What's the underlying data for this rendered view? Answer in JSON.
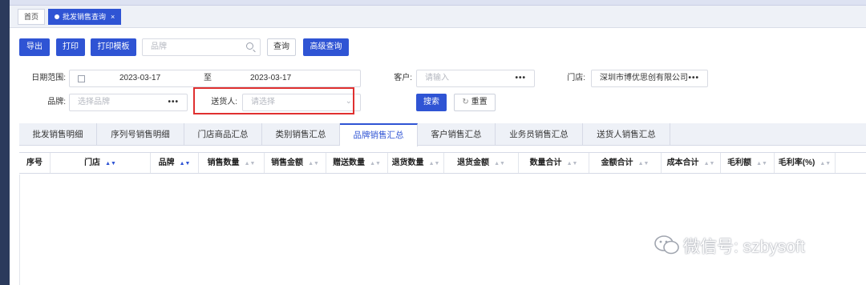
{
  "page_tabs": [
    {
      "label": "首页"
    },
    {
      "label": "批发销售查询",
      "close": "×"
    }
  ],
  "toolbar": {
    "export": "导出",
    "print": "打印",
    "print_template": "打印模板",
    "brand_placeholder": "品牌",
    "query": "查询",
    "advanced_query": "高级查询"
  },
  "filters": {
    "date_label": "日期范围:",
    "date_from": "2023-03-17",
    "date_sep": "至",
    "date_to": "2023-03-17",
    "customer_label": "客户:",
    "customer_placeholder": "请输入",
    "store_label": "门店:",
    "store_value": "深圳市博优思创有限公司",
    "brand_label": "品牌:",
    "brand_placeholder": "选择品牌",
    "deliverer_label": "送货人:",
    "deliverer_placeholder": "请选择",
    "search": "搜索",
    "reset": "重置",
    "dots": "•••"
  },
  "report_tabs": [
    "批发销售明细",
    "序列号销售明细",
    "门店商品汇总",
    "类别销售汇总",
    "品牌销售汇总",
    "客户销售汇总",
    "业务员销售汇总",
    "送货人销售汇总"
  ],
  "active_report_tab": "品牌销售汇总",
  "columns": [
    "序号",
    "门店",
    "品牌",
    "销售数量",
    "销售金额",
    "赠送数量",
    "退货数量",
    "退货金额",
    "数量合计",
    "金额合计",
    "成本合计",
    "毛利额",
    "毛利率(%)"
  ],
  "watermark": "微信号: szbysoft",
  "colors": {
    "primary": "#2f54d4",
    "highlight_box": "#e03030"
  }
}
